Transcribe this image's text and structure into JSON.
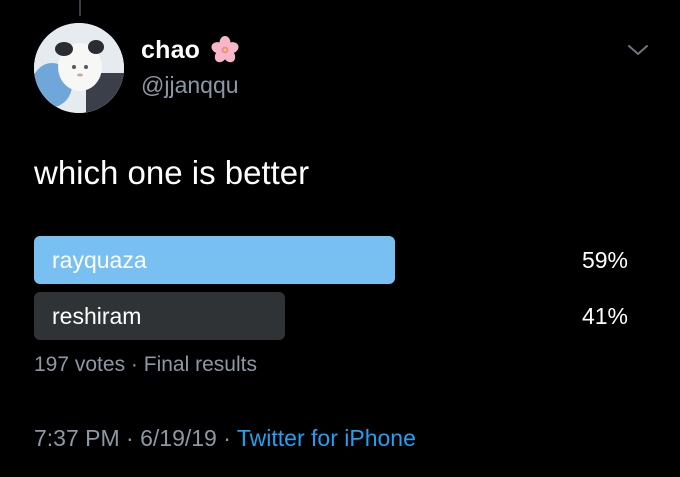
{
  "user": {
    "display_name": "chao",
    "handle": "@jjanqqu",
    "avatar_icon": "profile-avatar-plush-toy",
    "name_emoji": "cherry-blossom-icon"
  },
  "tweet": {
    "text": "which one is better"
  },
  "poll": {
    "options": [
      {
        "label": "rayquaza",
        "percent_label": "59%",
        "percent": 59,
        "winner": true,
        "bar_color": "#79c0f2",
        "label_color": "#ffffff"
      },
      {
        "label": "reshiram",
        "percent_label": "41%",
        "percent": 41,
        "winner": false,
        "bar_color": "#2f3336",
        "label_color": "#ffffff"
      }
    ],
    "votes": "197 votes",
    "separator": " · ",
    "status": "Final results"
  },
  "meta": {
    "time": "7:37 PM",
    "date": "6/19/19",
    "separator": " · ",
    "source": "Twitter for iPhone"
  },
  "colors": {
    "background": "#000000",
    "secondary_text": "#8b98a5",
    "link": "#1da1f2",
    "winning_bar": "#79c0f2",
    "losing_bar": "#2f3336"
  },
  "icons": {
    "menu": "chevron-down-icon"
  }
}
